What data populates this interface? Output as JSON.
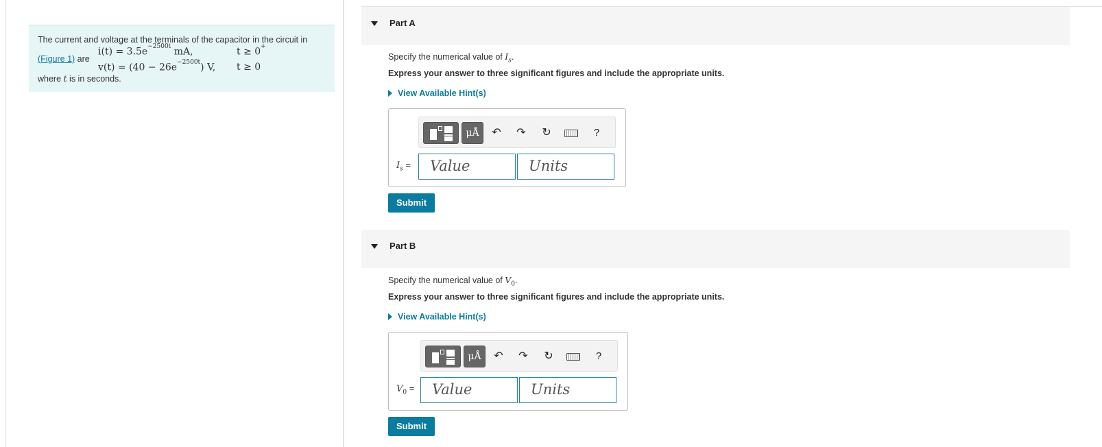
{
  "problem": {
    "intro": "The current and voltage at the terminals of the capacitor in the circuit in",
    "figure_link": "(Figure 1)",
    "are": "are",
    "eq_i_lhs": "i(t) = 3.5e",
    "eq_i_exp": "−2500t",
    "eq_i_unit": " mA,",
    "eq_v_lhs": "v(t) = (40 − 26e",
    "eq_v_exp": "−2500t",
    "eq_v_unit": ") V,",
    "cond_i": "t ≥ 0",
    "cond_i_sup": "+",
    "cond_v": "t ≥ 0",
    "outro_pre": "where",
    "outro_var": "t",
    "outro_post": "is in seconds."
  },
  "parts": [
    {
      "title": "Part A",
      "specify_pre": "Specify the numerical value of",
      "specify_var": "I",
      "specify_sub": "s",
      "express": "Express your answer to three significant figures and include the appropriate units.",
      "hint": "View Available Hint(s)",
      "answer_var": "I",
      "answer_sub": "s",
      "answer_eq": "=",
      "value_placeholder": "Value",
      "units_placeholder": "Units",
      "submit": "Submit"
    },
    {
      "title": "Part B",
      "specify_pre": "Specify the numerical value of",
      "specify_var": "V",
      "specify_sub": "0",
      "express": "Express your answer to three significant figures and include the appropriate units.",
      "hint": "View Available Hint(s)",
      "answer_var": "V",
      "answer_sub": "0",
      "answer_eq": "=",
      "value_placeholder": "Value",
      "units_placeholder": "Units",
      "submit": "Submit"
    }
  ],
  "toolbar": {
    "mu_label": "μÅ",
    "undo_icon": "↶",
    "redo_icon": "↷",
    "reset_icon": "↻",
    "help_label": "?"
  },
  "colors": {
    "accent": "#0a7ca0",
    "problem_bg": "#e6f5f6",
    "header_bg": "#f5f5f5"
  }
}
